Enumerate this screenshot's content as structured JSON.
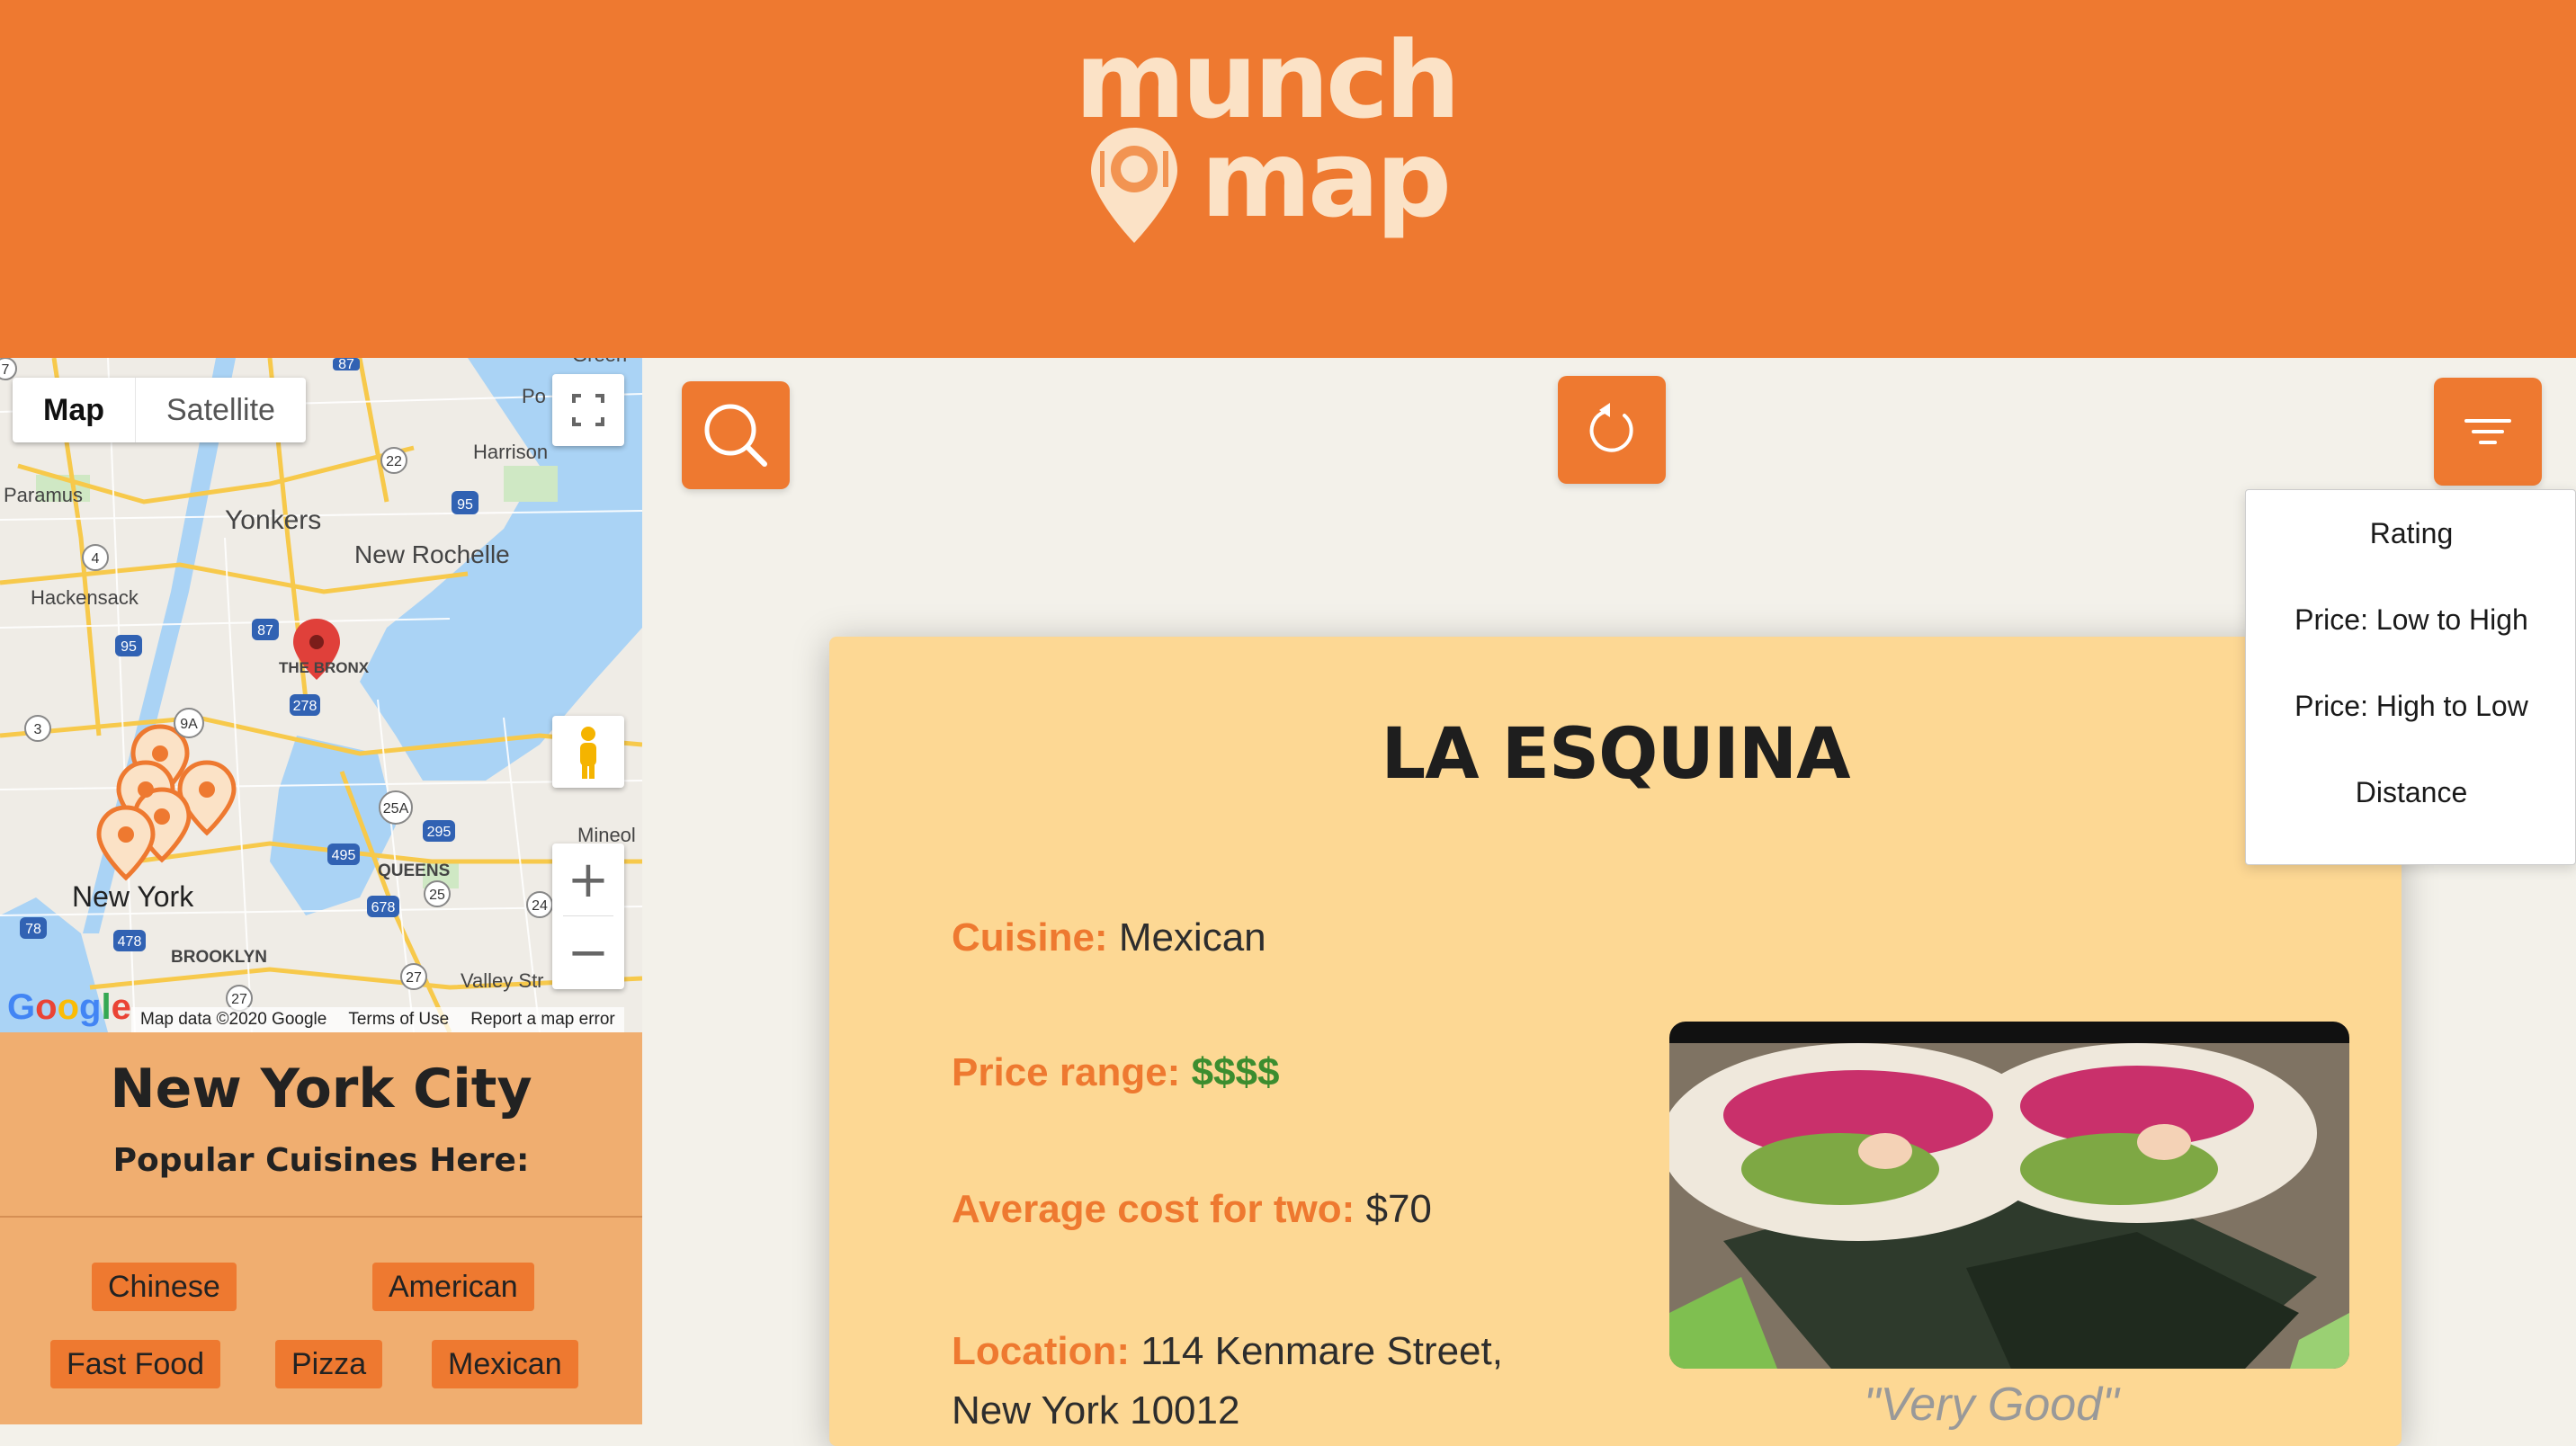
{
  "app": {
    "logo_line1": "munch",
    "logo_line2": "map",
    "brand_color": "#ee7930"
  },
  "map": {
    "type_controls": [
      "Map",
      "Satellite"
    ],
    "active_type": "Map",
    "place_labels": [
      "Yonkers",
      "New Rochelle",
      "Paramus",
      "Hackensack",
      "Harrison",
      "THE BRONX",
      "QUEENS",
      "New York",
      "BROOKLYN",
      "Valley Str",
      "Mineol",
      "Green",
      "Po"
    ],
    "highway_shields": [
      "87",
      "22",
      "95",
      "4",
      "87",
      "95",
      "278",
      "9A",
      "25A",
      "295",
      "495",
      "678",
      "25",
      "24",
      "78",
      "478",
      "27",
      "27",
      "3",
      "7"
    ],
    "google_logo": "Google",
    "footer": [
      "Map data ©2020 Google",
      "Terms of Use",
      "Report a map error"
    ]
  },
  "city": {
    "name": "New York City",
    "subtitle": "Popular Cuisines Here:",
    "cuisines": [
      "Chinese",
      "American",
      "Fast Food",
      "Pizza",
      "Mexican"
    ]
  },
  "toolbar": {
    "search_icon": "search-icon",
    "refresh_icon": "refresh-icon",
    "filter_icon": "filter-icon"
  },
  "sort_menu": {
    "options": [
      "Rating",
      "Price: Low to High",
      "Price: High to Low",
      "Distance"
    ]
  },
  "restaurant": {
    "name": "LA ESQUINA",
    "cuisine_label": "Cuisine:",
    "cuisine": "Mexican",
    "price_label": "Price range:",
    "price": "$$$$",
    "cost_label": "Average cost for two:",
    "cost": "$70",
    "location_label": "Location:",
    "location_line1": "114 Kenmare Street,",
    "location_line2": "New York 10012",
    "review": "\"Very Good\""
  }
}
